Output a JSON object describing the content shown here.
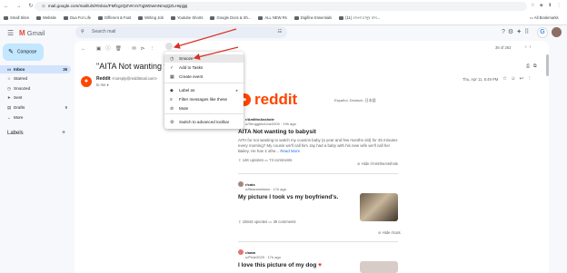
{
  "browser": {
    "url": "mail.google.com/mail/u/5/#inbox/FMfcgzQZVKVxTqjWDwmNmqQZLHspjjpj",
    "bookmarks": [
      "Small Sites",
      "Website",
      "Dua For Life",
      "Different & Fast",
      "Writing Job",
      "Youtube Shorts",
      "Google Docs & Sh...",
      "ALL NEW Rs",
      "Digifine Essentials",
      "(11) বাংলা মানুষ মান..."
    ],
    "all_bookmarks": "All Bookmarks"
  },
  "gmail": {
    "app_name": "Gmail",
    "search_placeholder": "Search mail",
    "compose": "Compose",
    "labels_heading": "Labels",
    "sidebar": [
      {
        "label": "Inbox",
        "count": "26",
        "icon": "inbox-icon"
      },
      {
        "label": "Starred",
        "count": "",
        "icon": "star-icon"
      },
      {
        "label": "Snoozed",
        "count": "",
        "icon": "clock-icon"
      },
      {
        "label": "Sent",
        "count": "",
        "icon": "send-icon"
      },
      {
        "label": "Drafts",
        "count": "9",
        "icon": "draft-icon"
      },
      {
        "label": "More",
        "count": "",
        "icon": "chevron-down-icon"
      }
    ],
    "pager": "36 of 262"
  },
  "email": {
    "subject": "\"AITA Not wanting to ba",
    "sender_name": "Reddit",
    "sender_email": "<noreply@redditmail.com>",
    "to": "to me",
    "date": "Thu, Apr 11, 8:49 PM",
    "language": "Español, Deutsch, 日本語",
    "reddit_wordmark": "reddit"
  },
  "posts": [
    {
      "subreddit": "r/AmItheAsshole",
      "meta": "u/Struggles4Joe2000 · 19h ago",
      "title": "AITA Not wanting to babysit",
      "text": "AITA for not wanting to watch my cousins baby (a year and few months old) for 45 minutes every morning? My cousin we'll call him Jay had a baby with his new wife we'll call her Bailey. He has 4 othe...",
      "more": "Read More",
      "upvotes": "14K upvotes",
      "comments": "74 comments",
      "hide": "Hide r/AmItheAsshole"
    },
    {
      "subreddit": "r/cats",
      "meta": "u/Beanmeldam · 17h ago",
      "title": "My picture I took vs my boyfriend's.",
      "upvotes": "10843 upvotes",
      "comments": "39 comments",
      "hide": "Hide r/cats"
    },
    {
      "subreddit": "r/aww",
      "meta": "u/Pixie2029 · 17h ago",
      "title": "I love this picture of my dog",
      "text": ""
    }
  ],
  "menu": [
    {
      "label": "Snooze",
      "icon": "clock-icon",
      "arrow": ""
    },
    {
      "label": "Add to Tasks",
      "icon": "tasks-icon",
      "arrow": ""
    },
    {
      "label": "Create event",
      "icon": "calendar-icon",
      "arrow": ""
    },
    {
      "label": "Label as",
      "icon": "label-icon",
      "arrow": "▸"
    },
    {
      "label": "Filter messages like these",
      "icon": "filter-icon",
      "arrow": ""
    },
    {
      "label": "Mute",
      "icon": "mute-icon",
      "arrow": ""
    },
    {
      "label": "Switch to advanced toolbar",
      "icon": "settings-icon",
      "arrow": ""
    }
  ],
  "colors": {
    "annotation_arrow": "#d93025",
    "reddit": "#ff4500",
    "inbox_highlight": "#d3e3fd",
    "compose": "#c2e7ff"
  }
}
